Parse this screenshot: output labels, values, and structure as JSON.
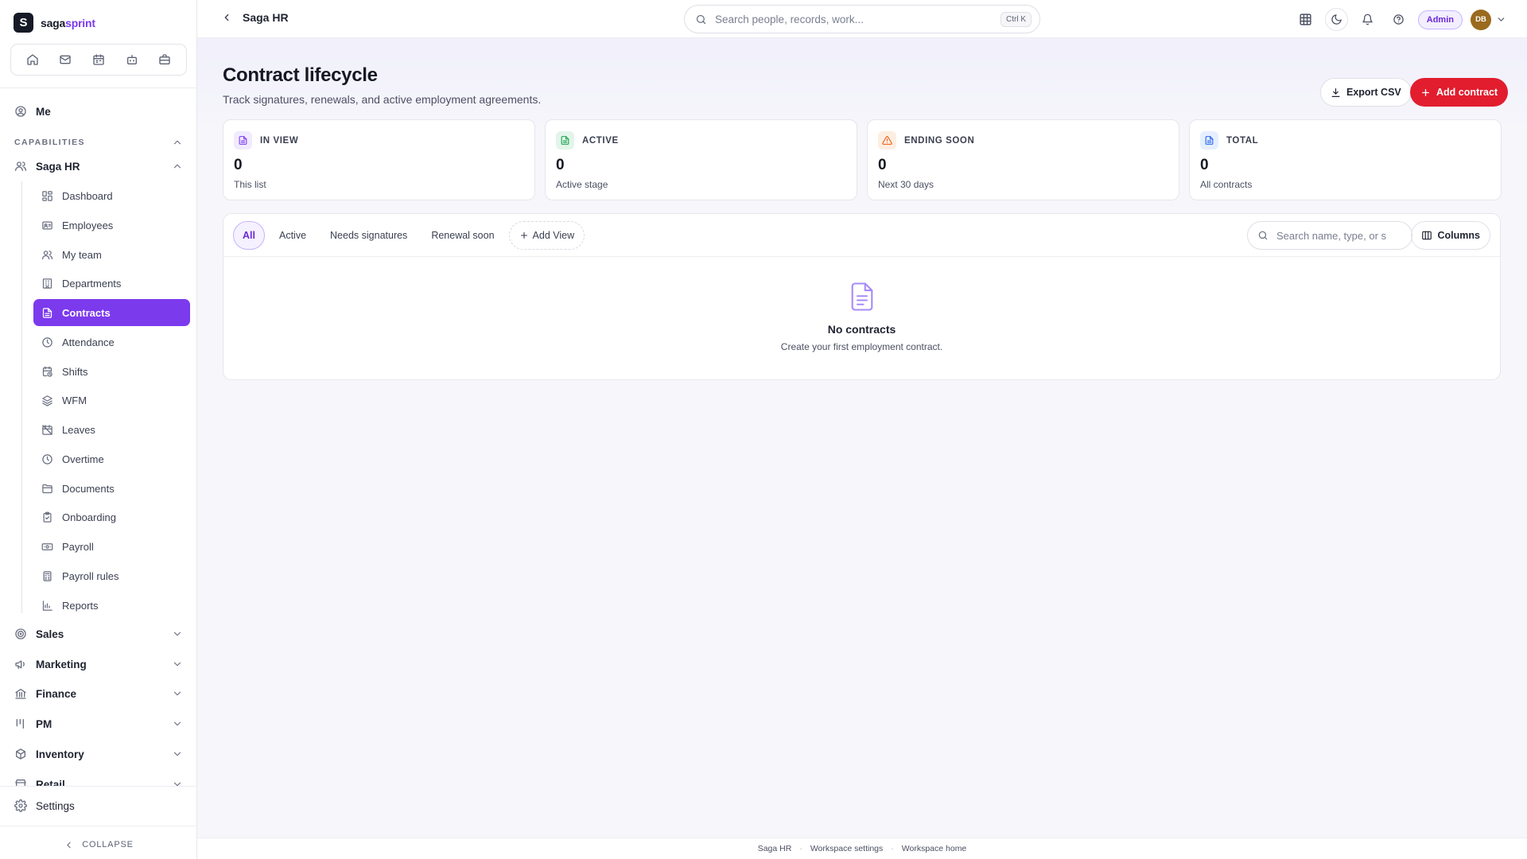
{
  "brand": {
    "logo_letter": "S",
    "name_part1": "saga",
    "name_part2": "sprint"
  },
  "sidebar": {
    "me_label": "Me",
    "capabilities_label": "CAPABILITIES",
    "group_label": "Saga HR",
    "items": [
      {
        "label": "Dashboard",
        "icon": "dashboard-icon"
      },
      {
        "label": "Employees",
        "icon": "id-card-icon"
      },
      {
        "label": "My team",
        "icon": "users-icon"
      },
      {
        "label": "Departments",
        "icon": "building-icon"
      },
      {
        "label": "Contracts",
        "icon": "document-icon",
        "active": true
      },
      {
        "label": "Attendance",
        "icon": "clock-icon"
      },
      {
        "label": "Shifts",
        "icon": "calendar-clock-icon"
      },
      {
        "label": "WFM",
        "icon": "layers-icon"
      },
      {
        "label": "Leaves",
        "icon": "calendar-off-icon"
      },
      {
        "label": "Overtime",
        "icon": "clock-icon"
      },
      {
        "label": "Documents",
        "icon": "folder-icon"
      },
      {
        "label": "Onboarding",
        "icon": "clipboard-icon"
      },
      {
        "label": "Payroll",
        "icon": "banknote-icon"
      },
      {
        "label": "Payroll rules",
        "icon": "calculator-icon"
      },
      {
        "label": "Reports",
        "icon": "bar-chart-icon"
      }
    ],
    "groups": [
      {
        "label": "Sales",
        "icon": "target-icon"
      },
      {
        "label": "Marketing",
        "icon": "megaphone-icon"
      },
      {
        "label": "Finance",
        "icon": "bank-icon"
      },
      {
        "label": "PM",
        "icon": "kanban-icon"
      },
      {
        "label": "Inventory",
        "icon": "package-icon"
      },
      {
        "label": "Retail",
        "icon": "store-icon"
      }
    ],
    "settings_label": "Settings",
    "collapse_label": "COLLAPSE"
  },
  "topbar": {
    "breadcrumb": "Saga HR",
    "search_placeholder": "Search people, records, work...",
    "search_shortcut": "Ctrl K",
    "role_badge": "Admin",
    "avatar_initials": "DB"
  },
  "page": {
    "title": "Contract lifecycle",
    "subtitle": "Track signatures, renewals, and active employment agreements.",
    "export_label": "Export CSV",
    "add_label": "Add contract"
  },
  "stats": [
    {
      "label": "IN VIEW",
      "value": "0",
      "caption": "This list",
      "color": "#7c3aed",
      "bg": "#f1ebff"
    },
    {
      "label": "ACTIVE",
      "value": "0",
      "caption": "Active stage",
      "color": "#16a34a",
      "bg": "#e3f5ea"
    },
    {
      "label": "ENDING SOON",
      "value": "0",
      "caption": "Next 30 days",
      "color": "#ea580c",
      "bg": "#fdeee2"
    },
    {
      "label": "TOTAL",
      "value": "0",
      "caption": "All contracts",
      "color": "#2563eb",
      "bg": "#e6efff"
    }
  ],
  "views": {
    "tabs": [
      "All",
      "Active",
      "Needs signatures",
      "Renewal soon"
    ],
    "active_tab": "All",
    "add_view_label": "Add View",
    "search_placeholder": "Search name, type, or s",
    "columns_label": "Columns"
  },
  "empty_state": {
    "title": "No contracts",
    "subtitle": "Create your first employment contract."
  },
  "footer": {
    "links": [
      "Saga HR",
      "Workspace settings",
      "Workspace home"
    ]
  },
  "colors": {
    "accent": "#7c3aed",
    "primary_action": "#e11d2e"
  }
}
